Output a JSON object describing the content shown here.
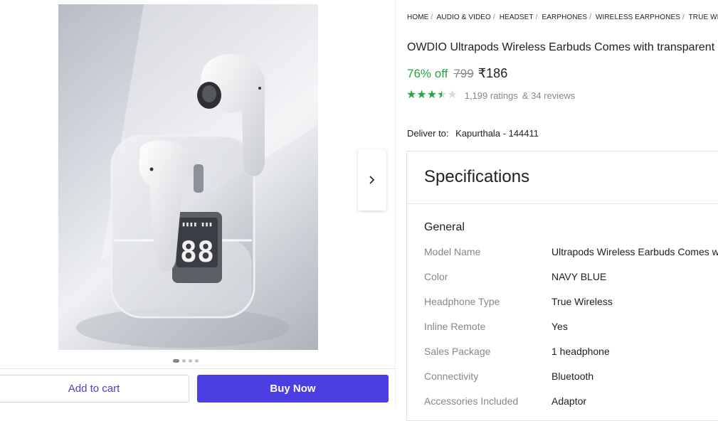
{
  "breadcrumb": [
    "HOME",
    "AUDIO & VIDEO",
    "HEADSET",
    "EARPHONES",
    "WIRELESS EARPHONES",
    "TRUE WIRELESS"
  ],
  "product": {
    "title": "OWDIO Ultrapods Wireless Earbuds Comes with transparent",
    "discount": "76% off",
    "mrp": "799",
    "price": "₹186",
    "rating_stars": 3.5,
    "ratings": "1,199 ratings",
    "reviews": "& 34 reviews"
  },
  "delivery": {
    "label": "Deliver to:",
    "location": "Kapurthala - 144411"
  },
  "image": {
    "display_text": "88",
    "carousel_count": 4,
    "active_index": 0
  },
  "actions": {
    "add_to_cart": "Add to cart",
    "buy_now": "Buy Now"
  },
  "specs": {
    "title": "Specifications",
    "section": "General",
    "rows": [
      {
        "key": "Model Name",
        "value": "Ultrapods Wireless Earbuds Comes with"
      },
      {
        "key": "Color",
        "value": "NAVY BLUE"
      },
      {
        "key": "Headphone Type",
        "value": "True Wireless"
      },
      {
        "key": "Inline Remote",
        "value": "Yes"
      },
      {
        "key": "Sales Package",
        "value": "1 headphone"
      },
      {
        "key": "Connectivity",
        "value": "Bluetooth"
      },
      {
        "key": "Accessories Included",
        "value": "Adaptor"
      }
    ]
  },
  "colors": {
    "accent": "#4b3fe4",
    "green": "#26a541",
    "muted": "#878787"
  }
}
